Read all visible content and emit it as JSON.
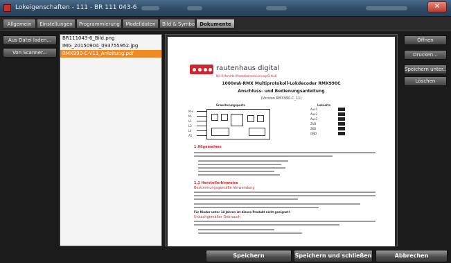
{
  "window": {
    "title": "Lokeigenschaften - 111 - BR 111 043-6",
    "close_glyph": "✕"
  },
  "tabs": [
    {
      "label": "Allgemein",
      "active": false
    },
    {
      "label": "Einstellungen",
      "active": false
    },
    {
      "label": "Programmierung",
      "active": false
    },
    {
      "label": "Modelldaten",
      "active": false
    },
    {
      "label": "Bild & Symbol",
      "active": false
    },
    {
      "label": "Dokumente",
      "active": true
    }
  ],
  "left_buttons": {
    "from_file": "Aus Datei laden...",
    "from_scanner": "Von Scanner..."
  },
  "files": [
    {
      "name": "BR111043-6_Bild.png",
      "selected": false
    },
    {
      "name": "IMG_20150904_093755952.jpg",
      "selected": false
    },
    {
      "name": "RMX990-C-V11_Anleitung.pdf",
      "selected": true
    }
  ],
  "document": {
    "brand": "rautenhaus digital",
    "brand_sub": "Mit Hilfsmittel Modellbahnsteuerung Schluß",
    "title": "1000mA-RMX Multiprotokoll-Lokdecoder RMX990C",
    "subtitle": "Anschluss- und Bedienungsanleitung",
    "version": "(Version RMX990-C_11)",
    "ports_left": "Erweiterungsports",
    "ports_right": "Lokseite",
    "left_pin_labels": [
      "M+",
      "M-",
      "L1",
      "L2",
      "LV",
      "A1"
    ],
    "right_pin_labels": [
      "Aux1",
      "Aux2",
      "Aux3",
      "ZVB",
      "ZKB",
      "GND"
    ],
    "section1": "1      Allgemeines",
    "section2": "1.1   Herstellerhinweise",
    "sub1": "Bestimmungsgemäße Verwendung",
    "sub2": "Unsachgemäßer Gebrauch",
    "warning": "Für Kinder unter 14 Jahren ist dieses Produkt nicht geeignet!"
  },
  "right_buttons": {
    "open": "Öffnen",
    "print": "Drucken...",
    "save_as": "Speichern unter...",
    "delete": "Löschen"
  },
  "bottom_buttons": {
    "save": "Speichern",
    "save_close": "Speichern und schließen",
    "cancel": "Abbrechen"
  },
  "colors": {
    "accent_orange": "#f08a24",
    "brand_red": "#d2262e",
    "titlebar_blue": "#2f4c66"
  }
}
